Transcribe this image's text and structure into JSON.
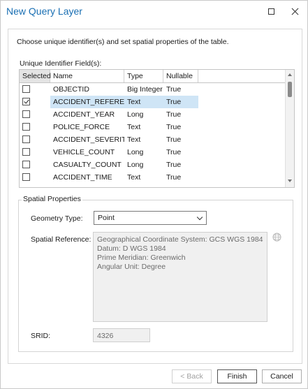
{
  "window": {
    "title": "New Query Layer"
  },
  "instruction": "Choose unique identifier(s) and set spatial properties of the table.",
  "uid_label": "Unique Identifier Field(s):",
  "grid": {
    "columns": [
      "Selected",
      "Name",
      "Type",
      "Nullable"
    ],
    "rows": [
      {
        "checked": false,
        "name": "OBJECTID",
        "type": "Big Integer",
        "nullable": "True"
      },
      {
        "checked": true,
        "name": "ACCIDENT_REFERENCE",
        "type": "Text",
        "nullable": "True"
      },
      {
        "checked": false,
        "name": "ACCIDENT_YEAR",
        "type": "Long",
        "nullable": "True"
      },
      {
        "checked": false,
        "name": "POLICE_FORCE",
        "type": "Text",
        "nullable": "True"
      },
      {
        "checked": false,
        "name": "ACCIDENT_SEVERITY",
        "type": "Text",
        "nullable": "True"
      },
      {
        "checked": false,
        "name": "VEHICLE_COUNT",
        "type": "Long",
        "nullable": "True"
      },
      {
        "checked": false,
        "name": "CASUALTY_COUNT",
        "type": "Long",
        "nullable": "True"
      },
      {
        "checked": false,
        "name": "ACCIDENT_TIME",
        "type": "Text",
        "nullable": "True"
      }
    ]
  },
  "spatial": {
    "group_title": "Spatial Properties",
    "geometry_label": "Geometry Type:",
    "geometry_value": "Point",
    "sr_label": "Spatial Reference:",
    "sr_lines": [
      "Geographical Coordinate System:  GCS WGS 1984",
      "Datum:  D WGS 1984",
      "Prime Meridian:  Greenwich",
      "Angular Unit:  Degree"
    ],
    "srid_label": "SRID:",
    "srid_value": "4326"
  },
  "buttons": {
    "back": "< Back",
    "finish": "Finish",
    "cancel": "Cancel"
  },
  "colors": {
    "title": "#1a6fb3",
    "selection": "#cfe5f6"
  }
}
